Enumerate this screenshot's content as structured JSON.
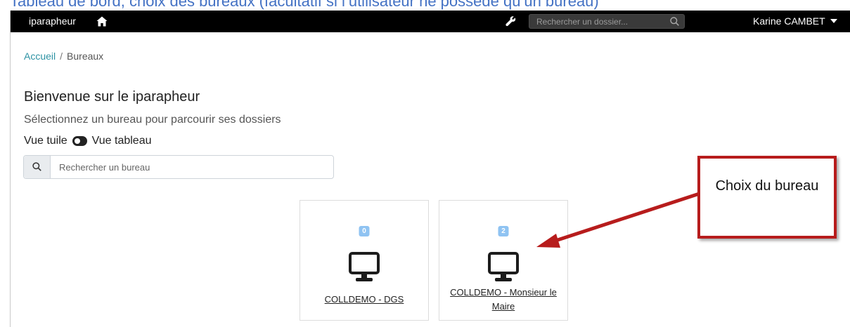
{
  "doc_caption": "Tableau de bord, choix des bureaux (facultatif si l’utilisateur ne possède qu’un bureau)",
  "navbar": {
    "brand": "iparapheur",
    "search_placeholder": "Rechercher un dossier...",
    "user_name": "Karine CAMBET",
    "icons": {
      "home": "home-icon",
      "admin": "wrench-icon",
      "search": "search-icon",
      "user_menu": "caret-down-icon"
    },
    "background": "#000000"
  },
  "breadcrumb": {
    "home": "Accueil",
    "separator": "/",
    "current": "Bureaux"
  },
  "main": {
    "title": "Bienvenue sur le iparapheur",
    "subtitle": "Sélectionnez un bureau pour parcourir ses dossiers",
    "view_toggle": {
      "left_label": "Vue tuile",
      "right_label": "Vue tableau"
    },
    "desk_search_placeholder": "Rechercher un bureau"
  },
  "desks": [
    {
      "name": "COLLDEMO - DGS",
      "count": "0",
      "icon": "desktop-icon"
    },
    {
      "name": "COLLDEMO - Monsieur le Maire",
      "count": "2",
      "icon": "desktop-icon"
    }
  ],
  "callout": {
    "text": "Choix du bureau",
    "border_color": "#b71c1c"
  },
  "colors": {
    "accent_link": "#2e93a4",
    "badge": "#8fc3f2",
    "caption": "#4472c4"
  }
}
